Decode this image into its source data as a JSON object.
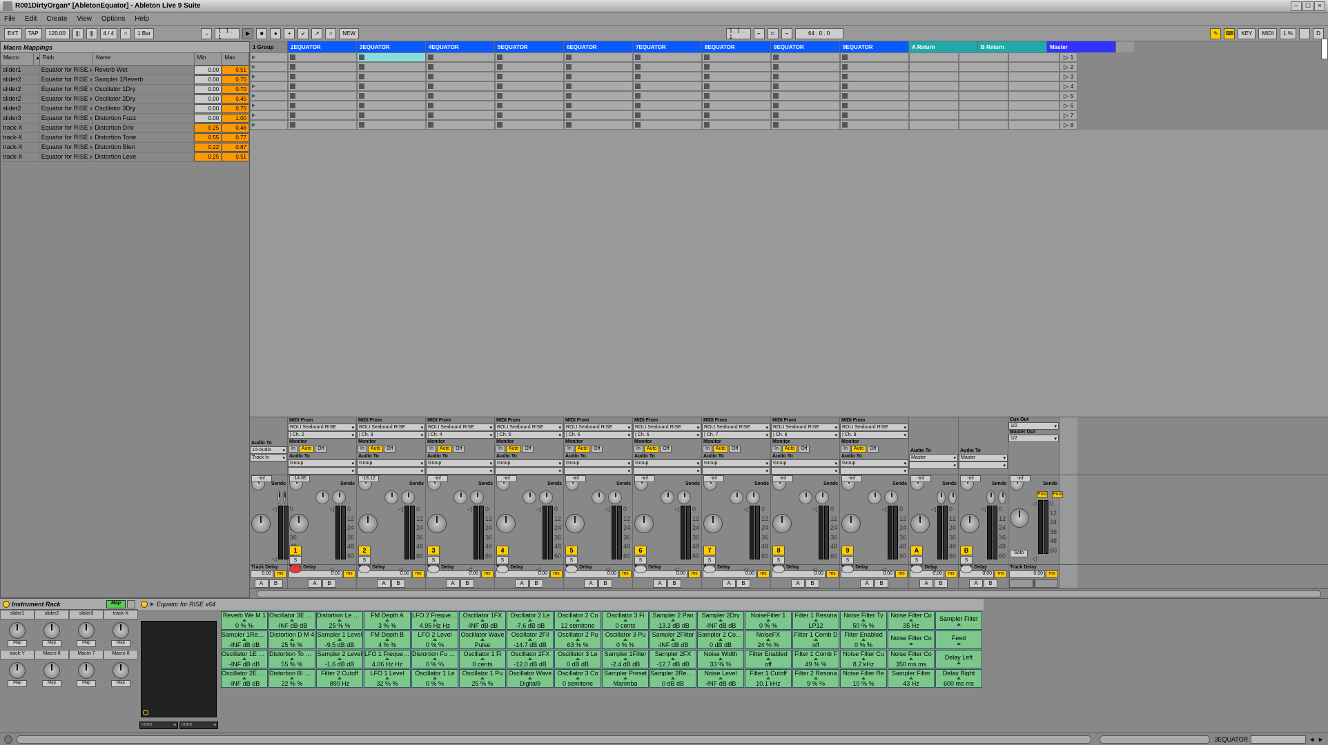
{
  "titlebar": {
    "title": "R001DirtyOrgan*  [AbletonEquator] - Ableton Live 9 Suite"
  },
  "menu": [
    "File",
    "Edit",
    "Create",
    "View",
    "Options",
    "Help"
  ],
  "toolbar": {
    "ext": "EXT",
    "tap": "TAP",
    "tempo": "120.00",
    "sig": "4 / 4",
    "bar": "1 Bar",
    "pos1": "1 . 1 . 1",
    "new": "NEW",
    "pos2": "1 . 1 . 1",
    "num1": "64 .   0 .   0",
    "key": "KEY",
    "midi": "MIDI",
    "pct": "1 %",
    "d": "D"
  },
  "macromap": {
    "title": "Macro Mappings",
    "cols": {
      "macro": "Macro",
      "path": "Path",
      "name": "Name",
      "min": "Min",
      "max": "Max"
    },
    "rows": [
      {
        "macro": "slider1",
        "path": "Equator for RISE x64",
        "name": "Reverb Wet",
        "min": "0.00",
        "max": "0.51",
        "hi": true
      },
      {
        "macro": "slider2",
        "path": "Equator for RISE x64",
        "name": "Sampler 1Reverb",
        "min": "0.00",
        "max": "0.70",
        "hi": true
      },
      {
        "macro": "slider2",
        "path": "Equator for RISE x64",
        "name": "Oscillator 1Dry",
        "min": "0.00",
        "max": "0.70",
        "hi": true
      },
      {
        "macro": "slider2",
        "path": "Equator for RISE x64",
        "name": "Oscillator 2Dry",
        "min": "0.00",
        "max": "0.45",
        "hi": true
      },
      {
        "macro": "slider2",
        "path": "Equator for RISE x64",
        "name": "Oscillator 3Dry",
        "min": "0.00",
        "max": "0.70",
        "hi": true
      },
      {
        "macro": "slider3",
        "path": "Equator for RISE x64",
        "name": "Distortion Fuzz",
        "min": "0.00",
        "max": "1.00",
        "hi": true
      },
      {
        "macro": "track-X",
        "path": "Equator for RISE x64",
        "name": "Distortion Driv",
        "min": "0.25",
        "max": "0.46",
        "hi": true,
        "minhi": true
      },
      {
        "macro": "track-X",
        "path": "Equator for RISE x64",
        "name": "Distortion Tone",
        "min": "0.55",
        "max": "0.77",
        "hi": true,
        "minhi": true
      },
      {
        "macro": "track-X",
        "path": "Equator for RISE x64",
        "name": "Distortion Blen",
        "min": "0.22",
        "max": "0.87",
        "hi": true,
        "minhi": true
      },
      {
        "macro": "track-X",
        "path": "Equator for RISE x64",
        "name": "Distortion Leve",
        "min": "0.25",
        "max": "0.51",
        "hi": true,
        "minhi": true
      }
    ]
  },
  "tracks": [
    {
      "name": "1 Group",
      "w": "first",
      "head": "gray"
    },
    {
      "name": "2EQUATOR",
      "ch": "Ch. 2",
      "db": "-14.86",
      "btn": "1",
      "rec": true
    },
    {
      "name": "3EQUATOR",
      "ch": "Ch. 3",
      "db": "-18.12",
      "btn": "2",
      "sel": true
    },
    {
      "name": "4EQUATOR",
      "ch": "Ch. 4",
      "db": "-inf",
      "btn": "3"
    },
    {
      "name": "5EQUATOR",
      "ch": "Ch. 5",
      "db": "-inf",
      "btn": "4"
    },
    {
      "name": "6EQUATOR",
      "ch": "Ch. 6",
      "db": "-inf",
      "btn": "5"
    },
    {
      "name": "7EQUATOR",
      "ch": "Ch. 6",
      "db": "-inf",
      "btn": "6"
    },
    {
      "name": "8EQUATOR",
      "ch": "Ch. 7",
      "db": "-inf",
      "btn": "7"
    },
    {
      "name": "9EQUATOR",
      "ch": "Ch. 8",
      "db": "-inf",
      "btn": "8"
    },
    {
      "name": "9EQUATOR",
      "ch": "Ch. 9",
      "db": "-inf",
      "btn": "9"
    }
  ],
  "returns": [
    {
      "name": "A Return",
      "btn": "A",
      "audio_to": "Master"
    },
    {
      "name": "B Return",
      "btn": "B",
      "audio_to": "Master"
    }
  ],
  "master": {
    "name": "Master",
    "cue": "Cue Out",
    "cueval": "1/2",
    "out": "Master Out",
    "outval": "1/2",
    "solo": "Solo",
    "post": "Post"
  },
  "io": {
    "midi_from": "MIDI From",
    "src": "ROLI Seaboard RISE",
    "monitor": "Monitor",
    "in": "In",
    "auto": "Auto",
    "off": "Off",
    "audio_to": "Audio To",
    "group": "Group",
    "tenaudio": "10-Audio",
    "track_in": "Track In"
  },
  "sends": "Sends",
  "ticks": [
    "0",
    "12",
    "24",
    "36",
    "48",
    "60"
  ],
  "delay": {
    "label": "Track Delay",
    "val": "0.00",
    "ms": "ms"
  },
  "ab": {
    "a": "A",
    "b": "B"
  },
  "scenes": [
    "1",
    "2",
    "3",
    "4",
    "5",
    "6",
    "7",
    "8"
  ],
  "rack": {
    "title": "Instrument Rack",
    "map": "Map",
    "tabs": [
      "slider1",
      "slider2",
      "slider3",
      "track-X"
    ],
    "tabs2": [
      "track-Y",
      "Macro 6",
      "Macro 7",
      "Macro 8"
    ],
    "map_lbl": "Map"
  },
  "device": {
    "title": "Equator for RISE x64",
    "dd1": "none",
    "dd2": "none"
  },
  "params": {
    "rows": [
      [
        [
          "Reverb We",
          "M 1"
        ],
        [
          "Oscillator 3E",
          "M 2"
        ],
        [
          "Distortion Le",
          "M 4"
        ],
        [
          "FM Depth A",
          ""
        ],
        [
          "LFO 2 Frequency",
          ""
        ],
        [
          "Oscillator 1FX",
          ""
        ],
        [
          "Oscillator 2 Le",
          ""
        ],
        [
          "Oscillator 2 Co",
          ""
        ],
        [
          "Oscillator 3 Fi",
          ""
        ],
        [
          "Sampler 2 Pan",
          ""
        ],
        [
          "Sampler 2Dry",
          ""
        ],
        [
          "NoiseFilter 1",
          ""
        ],
        [
          "Filter 1 Resona",
          ""
        ],
        [
          "Noise Filter Ty",
          ""
        ],
        [
          "Noise Filter Co",
          ""
        ],
        [
          "Sampler Filter",
          ""
        ]
      ],
      [
        [
          "",
          "0 % %"
        ],
        [
          "",
          "-INF dB dB"
        ],
        [
          "",
          "25 % %"
        ],
        [
          "",
          "3 % %"
        ],
        [
          "",
          "4.95 Hz Hz"
        ],
        [
          "",
          "-INF dB dB"
        ],
        [
          "",
          "-7.6 dB dB"
        ],
        [
          "",
          "12 semitone"
        ],
        [
          "",
          "0 cents"
        ],
        [
          "",
          "-13.3 dB dB"
        ],
        [
          "",
          "-INF dB dB"
        ],
        [
          "",
          "0 % %"
        ],
        [
          "",
          "LP12"
        ],
        [
          "",
          "50 % %"
        ],
        [
          "",
          "35 Hz"
        ],
        [
          "",
          ""
        ]
      ],
      [
        [
          "Sampler 1Rev",
          "M 2"
        ],
        [
          "Distortion D",
          "M 4"
        ],
        [
          "Sampler 1 Level",
          ""
        ],
        [
          "FM Depth B",
          ""
        ],
        [
          "LFO 2 Level",
          ""
        ],
        [
          "Oscillator Wave",
          ""
        ],
        [
          "Oscillator 2Fil",
          ""
        ],
        [
          "Oscillator 2 Pu",
          ""
        ],
        [
          "Oscillator 3 Pu",
          ""
        ],
        [
          "Sampler 2Filter",
          ""
        ],
        [
          "Sampler 2 Coars",
          ""
        ],
        [
          "NoiseFX",
          ""
        ],
        [
          "Filter 1 Comb D",
          ""
        ],
        [
          "Filter Enabled",
          ""
        ],
        [
          "Noise Filter Co",
          ""
        ],
        [
          "Feed",
          ""
        ]
      ],
      [
        [
          "",
          "-INF dB dB"
        ],
        [
          "",
          "25 % %"
        ],
        [
          "",
          "-9.5 dB dB"
        ],
        [
          "",
          "4 % %"
        ],
        [
          "",
          "0 % %"
        ],
        [
          "",
          "Pulse"
        ],
        [
          "",
          "-14.7 dB dB"
        ],
        [
          "",
          "63 % %"
        ],
        [
          "",
          "0 % %"
        ],
        [
          "",
          "-INF dB dB"
        ],
        [
          "",
          "0 dB dB"
        ],
        [
          "",
          "24 % %"
        ],
        [
          "",
          "off"
        ],
        [
          "",
          "0 % %"
        ],
        [
          "",
          ""
        ],
        [
          "",
          ""
        ]
      ],
      [
        [
          "Oscillator 1E",
          "M 2"
        ],
        [
          "Distortion To",
          "M 4"
        ],
        [
          "Sampler 2 Level",
          ""
        ],
        [
          "LFO 1 Frequency",
          ""
        ],
        [
          "Distortion Fu",
          "M 3"
        ],
        [
          "Oscillator 1 Fi",
          ""
        ],
        [
          "Oscillator 2FX",
          ""
        ],
        [
          "Oscillator 3 Le",
          ""
        ],
        [
          "Sampler 1Filter",
          ""
        ],
        [
          "Sampler 2FX",
          ""
        ],
        [
          "Noise Width",
          ""
        ],
        [
          "Filter Enabled",
          ""
        ],
        [
          "Filter 1 Comb F",
          ""
        ],
        [
          "Noise Filter Cu",
          ""
        ],
        [
          "Noise Filter Co",
          ""
        ],
        [
          "Delay Left",
          ""
        ]
      ],
      [
        [
          "",
          "-INF dB dB"
        ],
        [
          "",
          "55 % %"
        ],
        [
          "",
          "-1.6 dB dB"
        ],
        [
          "",
          "4.06 Hz Hz"
        ],
        [
          "",
          "0 % %"
        ],
        [
          "",
          "0 cents"
        ],
        [
          "",
          "-12.0 dB dB"
        ],
        [
          "",
          "0 dB dB"
        ],
        [
          "",
          "-2.4 dB dB"
        ],
        [
          "",
          "-12.7 dB dB"
        ],
        [
          "",
          "33 % %"
        ],
        [
          "",
          "off"
        ],
        [
          "",
          "49 % %"
        ],
        [
          "",
          "8.2 kHz"
        ],
        [
          "",
          "350 ms ms"
        ],
        [
          "",
          ""
        ]
      ],
      [
        [
          "Oscillator 2E",
          "M 2"
        ],
        [
          "Distortion Bl",
          "M 4"
        ],
        [
          "Filter 2 Cutoff",
          ""
        ],
        [
          "LFO 1 Level",
          ""
        ],
        [
          "Oscillator 1 Le",
          ""
        ],
        [
          "Oscillator 1 Pu",
          ""
        ],
        [
          "Oscillator Wave",
          ""
        ],
        [
          "Oscillator 3 Co",
          ""
        ],
        [
          "Sampler Preset",
          ""
        ],
        [
          "Sampler 2Reverb",
          ""
        ],
        [
          "Noise Level",
          ""
        ],
        [
          "Filter 1 Cutoff",
          ""
        ],
        [
          "Filter 2 Resona",
          ""
        ],
        [
          "Noise Filter Re",
          ""
        ],
        [
          "Sampler Filter",
          ""
        ],
        [
          "Delay Right",
          ""
        ]
      ],
      [
        [
          "",
          "-INF dB dB"
        ],
        [
          "",
          "22 % %"
        ],
        [
          "",
          "890 Hz"
        ],
        [
          "",
          "32 % %"
        ],
        [
          "",
          "0 % %"
        ],
        [
          "",
          "25 % %"
        ],
        [
          "",
          "Digital9"
        ],
        [
          "",
          "0 semitone"
        ],
        [
          "",
          "Marimba"
        ],
        [
          "",
          "0 dB dB"
        ],
        [
          "",
          "-INF dB dB"
        ],
        [
          "",
          "10.1 kHz"
        ],
        [
          "",
          "9 % %"
        ],
        [
          "",
          "10 % %"
        ],
        [
          "",
          "43 Hz"
        ],
        [
          "",
          "600 ms ms"
        ]
      ]
    ]
  },
  "status": {
    "seg": "3EQUATOR"
  }
}
